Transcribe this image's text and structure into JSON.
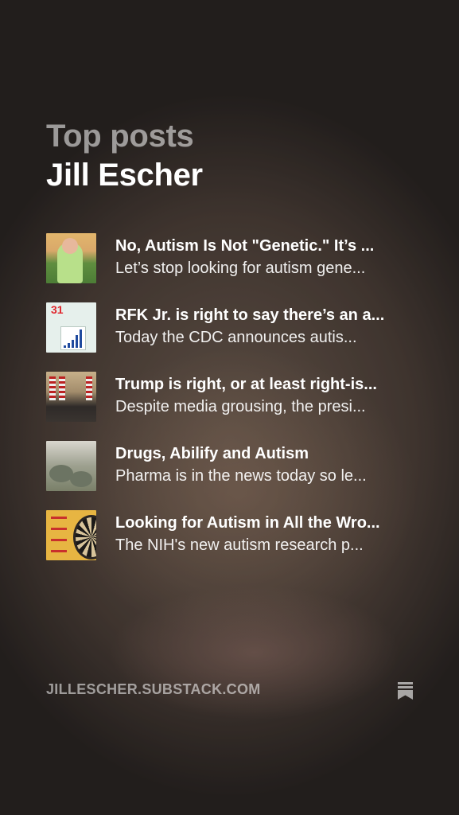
{
  "header": {
    "kicker": "Top posts",
    "author": "Jill Escher"
  },
  "posts": [
    {
      "title": "No, Autism Is Not \"Genetic.\" It’s ...",
      "subtitle": "Let’s stop looking for autism gene...",
      "thumb_icon": "person-outdoors-thumbnail"
    },
    {
      "title": "RFK Jr. is right to say there’s an a...",
      "subtitle": "Today the CDC announces autis...",
      "thumb_icon": "infographic-chart-thumbnail",
      "thumb_text": "31"
    },
    {
      "title": "Trump is right, or at least right-is...",
      "subtitle": "Despite media grousing, the presi...",
      "thumb_icon": "press-conference-thumbnail"
    },
    {
      "title": "Drugs, Abilify and Autism",
      "subtitle": "Pharma is in the news today so le...",
      "thumb_icon": "pills-thumbnail"
    },
    {
      "title": "Looking for Autism in All the Wro...",
      "subtitle": "The NIH's new autism research p...",
      "thumb_icon": "dartboard-thumbnail"
    }
  ],
  "footer": {
    "domain": "JILLESCHER.SUBSTACK.COM",
    "logo_icon": "substack-logo-icon"
  }
}
